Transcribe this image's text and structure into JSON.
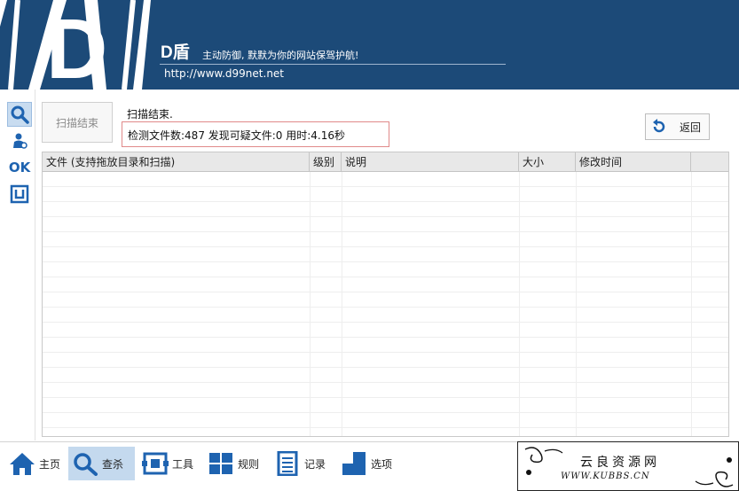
{
  "header": {
    "brand": "D盾",
    "slogan": "主动防御, 默默为你的网站保驾护航!",
    "url": "http://www.d99net.net"
  },
  "sidebar": {
    "items": [
      {
        "name": "search-icon",
        "active": true
      },
      {
        "name": "user-scan-icon",
        "active": false
      },
      {
        "name": "ok-icon",
        "label": "OK",
        "active": false
      },
      {
        "name": "bracket-icon",
        "active": false
      }
    ]
  },
  "scan": {
    "button_label": "扫描结束",
    "status_title": "扫描结束.",
    "result_text": "检测文件数:487 发现可疑文件:0 用时:4.16秒",
    "back_label": "返回"
  },
  "table": {
    "columns": [
      "文件 (支持拖放目录和扫描)",
      "级别",
      "说明",
      "大小",
      "修改时间"
    ],
    "rows": []
  },
  "bottom_nav": {
    "items": [
      {
        "label": "主页",
        "icon": "home-icon"
      },
      {
        "label": "查杀",
        "icon": "search-icon",
        "active": true
      },
      {
        "label": "工具",
        "icon": "tools-icon"
      },
      {
        "label": "规则",
        "icon": "rules-icon"
      },
      {
        "label": "记录",
        "icon": "log-icon"
      },
      {
        "label": "选项",
        "icon": "options-icon"
      }
    ]
  },
  "watermark": {
    "title": "云良资源网",
    "url": "WWW.KUBBS.CN"
  },
  "colors": {
    "header_bg": "#1c4a78",
    "accent": "#2a6db5",
    "active_bg": "#c4d9ee",
    "result_border": "#e08a8a"
  }
}
